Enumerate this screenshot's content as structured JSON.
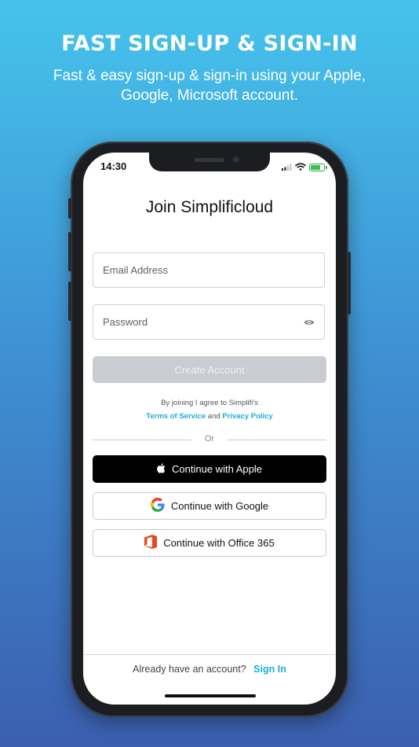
{
  "promo": {
    "headline": "FAST SIGN-UP & SIGN-IN",
    "subheadline": "Fast & easy sign-up & sign-in using your Apple, Google, Microsoft account."
  },
  "status_bar": {
    "time": "14:30",
    "icons": [
      "signal-icon",
      "wifi-icon",
      "battery-charging-icon"
    ],
    "battery_level": 0.8
  },
  "screen": {
    "title": "Join Simplificloud",
    "email": {
      "placeholder": "Email Address",
      "value": ""
    },
    "password": {
      "placeholder": "Password",
      "value": "",
      "icon": "eye-icon"
    },
    "create_account_label": "Create Account",
    "terms": {
      "prefix": "By joining I agree to Simplifi's",
      "terms_link": "Terms of Service",
      "and": "and",
      "privacy_link": "Privacy Policy"
    },
    "divider_label": "Or",
    "social_buttons": [
      {
        "label": "Continue with Apple",
        "icon": "apple-icon"
      },
      {
        "label": "Continue with Google",
        "icon": "google-icon"
      },
      {
        "label": "Continue with Office 365",
        "icon": "office-365-icon"
      }
    ],
    "footer": {
      "prompt": "Already have an account?",
      "signin_label": "Sign In"
    }
  },
  "colors": {
    "accent": "#1aaed6",
    "apple_button": "#000000",
    "create_disabled": "#c9ccd1",
    "gradient_top": "#45c3ec",
    "gradient_bottom": "#3b5fae"
  }
}
